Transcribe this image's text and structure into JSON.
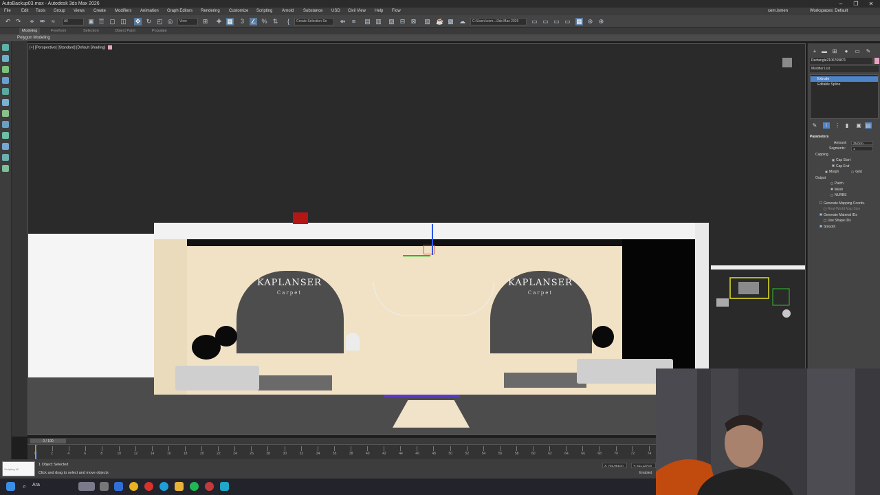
{
  "window": {
    "title": "AutoBackup03.max - Autodesk 3ds Max 2026",
    "controls": [
      "–",
      "❐",
      "✕"
    ]
  },
  "menu": {
    "items": [
      "File",
      "Edit",
      "Tools",
      "Group",
      "Views",
      "Create",
      "Modifiers",
      "Animation",
      "Graph Editors",
      "Rendering",
      "Customize",
      "Scripting",
      "Arnold",
      "Substance",
      "USD",
      "Civil View",
      "Help",
      "Flow"
    ],
    "user": "cem.ismen",
    "workspace_label": "Workspaces: Default"
  },
  "toolbar": {
    "selection_filter": "All",
    "ref_coord": "View",
    "named_selection": "Create Selection Se",
    "project_path": "C:\\Users\\cem...\\3ds Max 2026"
  },
  "ribbon": {
    "tabs": [
      "Modeling",
      "Freeform",
      "Selection",
      "Object Paint",
      "Populate"
    ],
    "active_tab": "Modeling",
    "panel_label": "Polygon Modeling"
  },
  "viewport": {
    "label": "[+] [Perspective] [Standard] [Default Shading]",
    "logo_text": "KAPLANSER",
    "logo_sub": "Carpet"
  },
  "command_panel": {
    "object_name": "Rectangle2106769871",
    "modifier_list": "Modifier List",
    "stack": [
      "Extrude",
      "Editable Spline"
    ],
    "selected_modifier": "Extrude",
    "parameters": {
      "title": "Parameters",
      "amount_label": "Amount:",
      "amount_value": "25,0cm",
      "segments_label": "Segments:",
      "segments_value": "1",
      "capping_label": "Capping",
      "cap_start": "Cap Start",
      "cap_end": "Cap End",
      "morph": "Morph",
      "grid": "Grid",
      "output_label": "Output",
      "patch": "Patch",
      "mesh": "Mesh",
      "nurbs": "NURBS",
      "gen_mapping": "Generate Mapping Coords.",
      "real_world": "Real-World Map Size",
      "gen_material": "Generate Material IDs",
      "use_shape_ids": "Use Shape IDs",
      "smooth": "Smooth"
    }
  },
  "timeline": {
    "frame_display": "0 / 100",
    "ticks": [
      0,
      2,
      4,
      6,
      8,
      10,
      12,
      14,
      16,
      18,
      20,
      22,
      24,
      26,
      28,
      30,
      32,
      34,
      36,
      38,
      40,
      42,
      44,
      46,
      48,
      50,
      52,
      54,
      56,
      58,
      60,
      62,
      64,
      66,
      68,
      70,
      72,
      74,
      76
    ]
  },
  "status": {
    "selection": "1 Object Selected",
    "prompt": "Click and drag to select and move objects",
    "maxscript": "Scripting Mi",
    "x_coord": "X: 702,961cm",
    "y_coord": "Y: 511,127cm",
    "enabled": "Enabled"
  },
  "taskbar": {
    "search": "Ara"
  },
  "colors": {
    "accent": "#4e84c9",
    "wall": "#f1e2c5",
    "viewport_bg": "#2a2a2a"
  }
}
